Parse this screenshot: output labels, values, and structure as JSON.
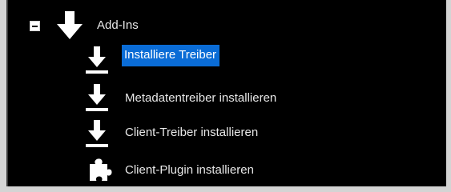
{
  "tree": {
    "root": {
      "label": "Add-Ins",
      "expanded": true,
      "icon": "download-arrow-icon"
    },
    "children": [
      {
        "label": "Installiere Treiber",
        "icon": "download-tray-icon",
        "selected": true
      },
      {
        "label": "Metadatentreiber installieren",
        "icon": "download-tray-icon",
        "selected": false
      },
      {
        "label": "Client-Treiber installieren",
        "icon": "download-tray-icon",
        "selected": false
      },
      {
        "label": "Client-Plugin installieren",
        "icon": "puzzle-piece-icon",
        "selected": false
      }
    ]
  },
  "colors": {
    "background": "#000000",
    "selection": "#0a6cd6",
    "text": "#e8e8e8"
  }
}
